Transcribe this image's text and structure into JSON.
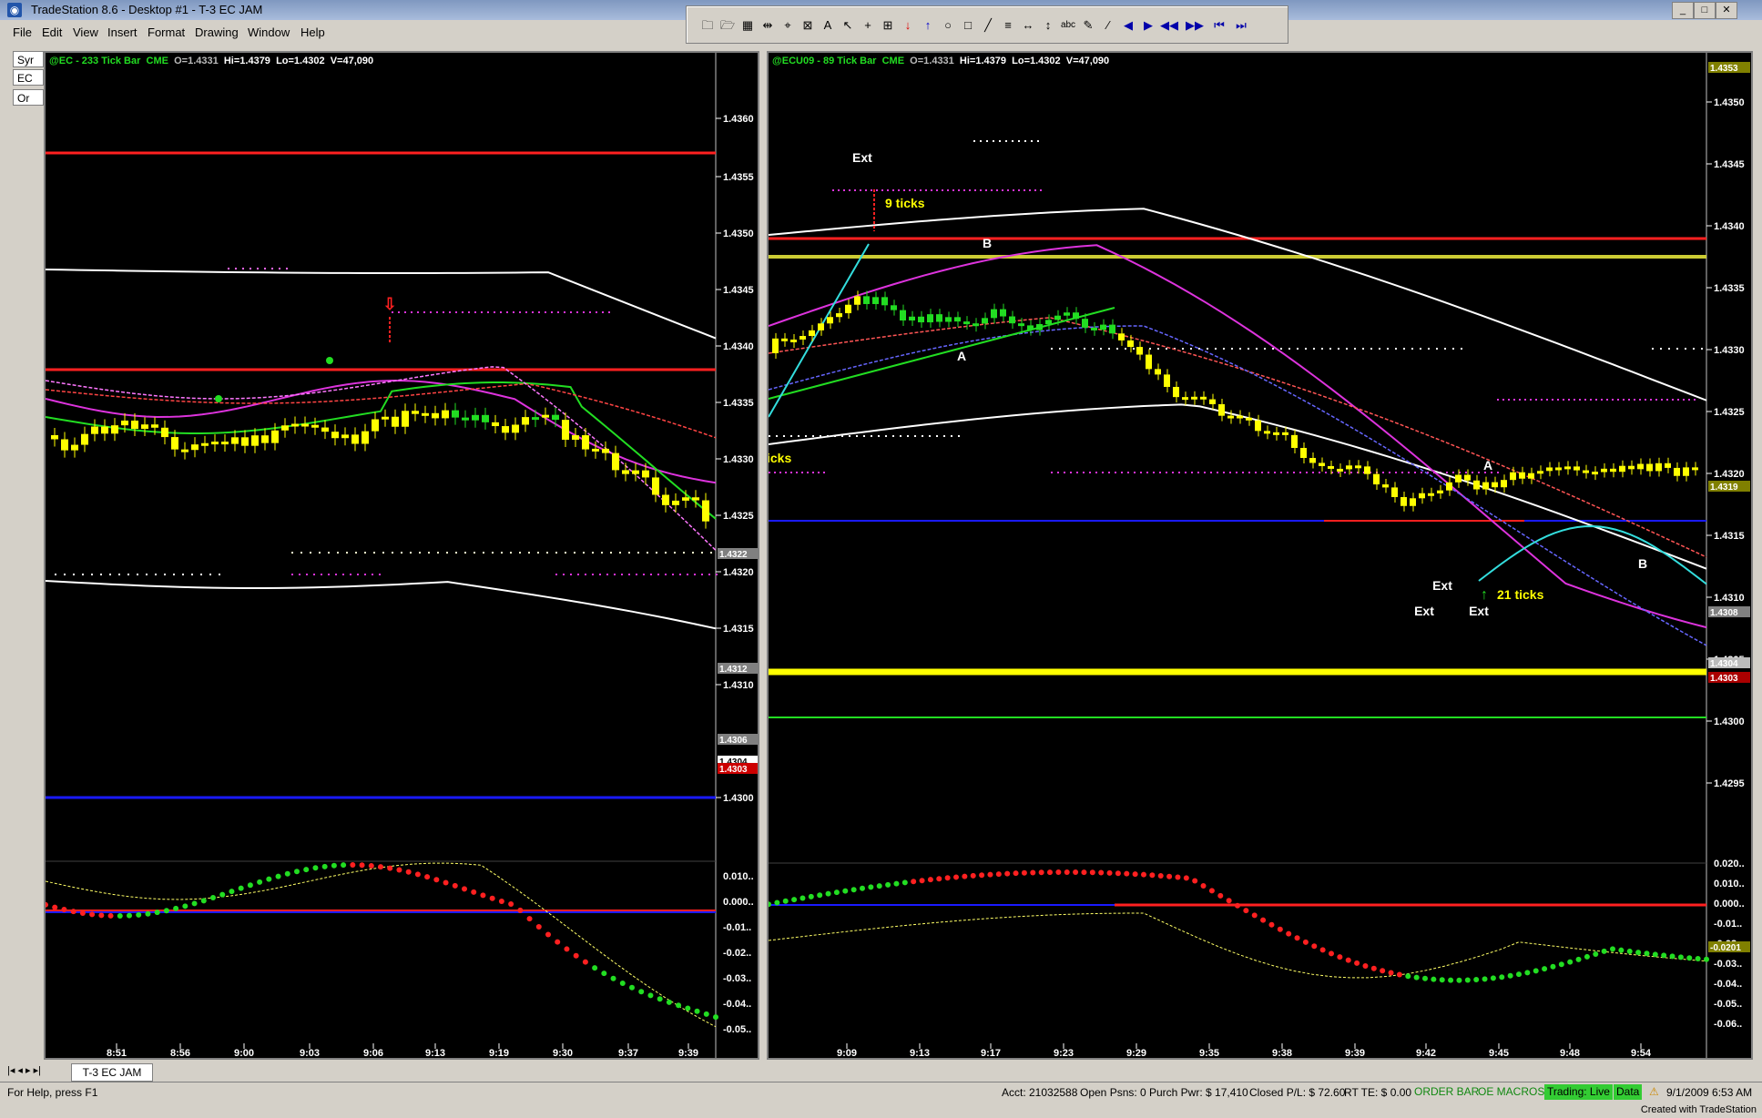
{
  "window": {
    "title": "TradeStation 8.6 - Desktop #1 - T-3 EC JAM"
  },
  "menu": [
    "File",
    "Edit",
    "View",
    "Insert",
    "Format",
    "Drawing",
    "Window",
    "Help"
  ],
  "left_panel": {
    "items": [
      "Syr",
      "EC",
      "Or"
    ]
  },
  "chart_left": {
    "header": {
      "symbol": "@EC - 233 Tick Bar",
      "exchange": "CME",
      "open": "O=1.4331",
      "high": "Hi=1.4379",
      "low": "Lo=1.4302",
      "volume": "V=47,090"
    },
    "price_ticks": [
      "1.4360",
      "1.4355",
      "1.4350",
      "1.4345",
      "1.4340",
      "1.4335",
      "1.4330",
      "1.4325",
      "1.4320",
      "1.4315",
      "1.4310",
      "1.4300"
    ],
    "price_tags": [
      "1.4322",
      "1.4312",
      "1.4306",
      "1.4304",
      "1.4303"
    ],
    "osc_ticks": [
      "0.010..",
      "0.000..",
      "-0.01..",
      "-0.02..",
      "-0.03..",
      "-0.04..",
      "-0.05.."
    ],
    "time_ticks": [
      "8:51",
      "8:56",
      "9:00",
      "9:03",
      "9:06",
      "9:13",
      "9:19",
      "9:30",
      "9:37",
      "9:39"
    ]
  },
  "chart_right": {
    "header": {
      "symbol": "@ECU09 - 89 Tick Bar",
      "exchange": "CME",
      "open": "O=1.4331",
      "high": "Hi=1.4379",
      "low": "Lo=1.4302",
      "volume": "V=47,090"
    },
    "price_ticks": [
      "1.4350",
      "1.4345",
      "1.4340",
      "1.4335",
      "1.4330",
      "1.4325",
      "1.4320",
      "1.4315",
      "1.4310",
      "1.4305",
      "1.4300",
      "1.4295"
    ],
    "price_tags": [
      "1.4353",
      "1.4319",
      "1.4308",
      "1.4304",
      "1.4303"
    ],
    "osc_ticks": [
      "0.020..",
      "0.010..",
      "0.000..",
      "-0.01..",
      "-0.02..",
      "-0.03..",
      "-0.04..",
      "-0.05..",
      "-0.06.."
    ],
    "osc_tags": [
      "-0.0201"
    ],
    "time_ticks": [
      "9:09",
      "9:13",
      "9:17",
      "9:23",
      "9:29",
      "9:35",
      "9:38",
      "9:39",
      "9:42",
      "9:45",
      "9:48",
      "9:54"
    ],
    "annotations": {
      "nine_ticks": "9 ticks",
      "twentyone_ticks": "21 ticks",
      "ext": "Ext",
      "a": "A",
      "b": "B",
      "ticks_partial": "icks"
    }
  },
  "tabs": {
    "active": "T-3 EC JAM"
  },
  "status": {
    "help": "For Help, press F1",
    "acct": "Acct: 21032588",
    "open_psns": "Open Psns: 0",
    "purch_pwr": "Purch Pwr: $ 17,410",
    "closed_pl": "Closed P/L: $ 72.60",
    "rt_te": "RT TE: $ 0.00",
    "order_bar": "ORDER BAR",
    "oe_macros": "OE MACROS",
    "trading": "Trading: Live",
    "data": "Data",
    "datetime": "9/1/2009 6:53 AM"
  },
  "footer": "Created with TradeStation",
  "colors": {
    "red": "#ff2020",
    "blue": "#1a1aff",
    "yellow": "#ffff00",
    "green": "#22dd22",
    "magenta": "#dd33dd",
    "white": "#ffffff",
    "cyan": "#33dddd"
  }
}
